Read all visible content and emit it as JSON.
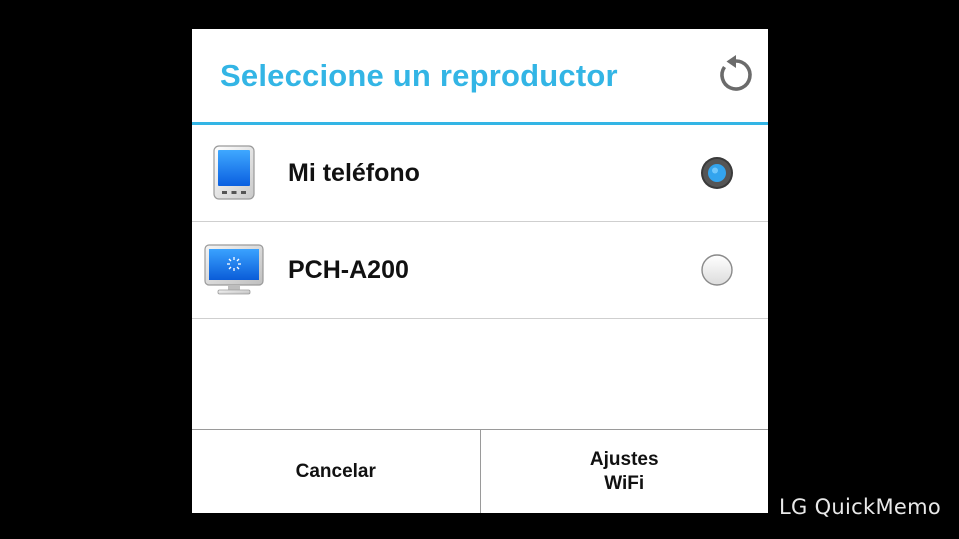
{
  "dialog": {
    "title": "Seleccione un reproductor",
    "refresh_icon": "refresh-icon",
    "accent_color": "#33b5e5"
  },
  "devices": [
    {
      "name": "Mi teléfono",
      "icon": "phone-icon",
      "selected": true
    },
    {
      "name": "PCH-A200",
      "icon": "monitor-icon",
      "selected": false
    }
  ],
  "footer": {
    "cancel_label": "Cancelar",
    "settings_label_line1": "Ajustes",
    "settings_label_line2": "WiFi"
  },
  "watermark": "LG QuickMemo"
}
